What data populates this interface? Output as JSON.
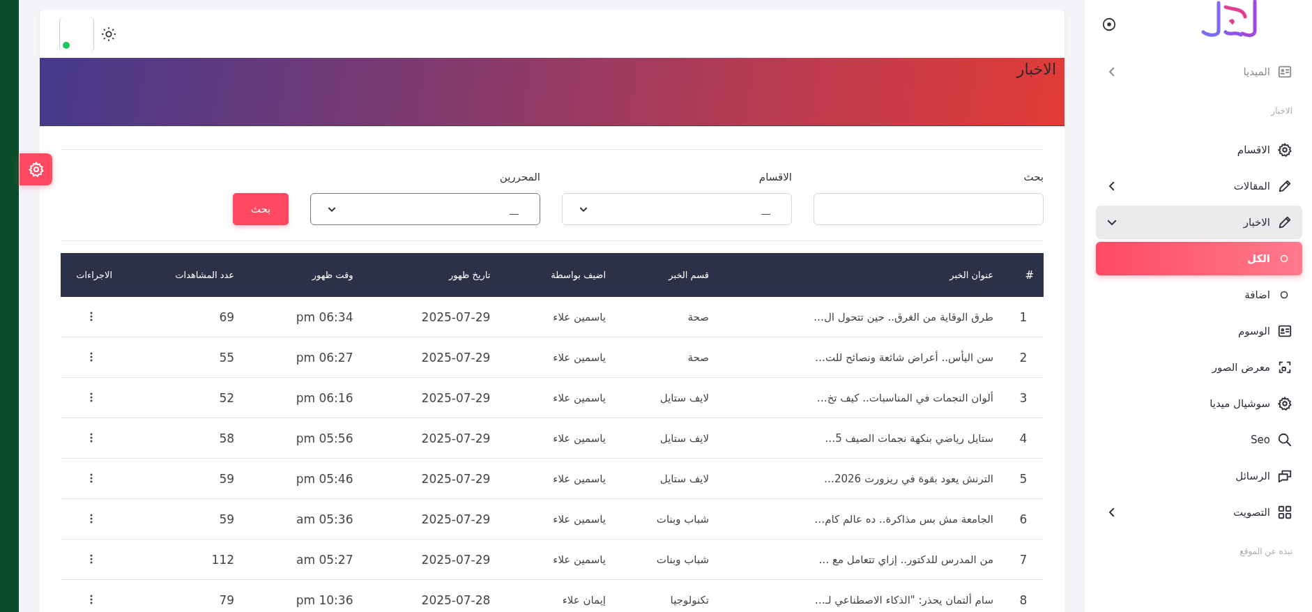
{
  "topbar": {
    "online": true
  },
  "page_title": "الاخبار",
  "filters": {
    "search": {
      "label": "بحث"
    },
    "selects": [
      {
        "label": "الاقسام",
        "value": "__",
        "focused": false
      },
      {
        "label": "المحررين",
        "value": "__",
        "focused": true
      }
    ],
    "button": "بحث"
  },
  "table": {
    "columns": [
      "#",
      "عنوان الخبر",
      "قسم الخبر",
      "اضيف بواسطة",
      "تاريخ ظهور",
      "وقت ظهور",
      "عدد المشاهدات",
      "الاجراءات"
    ],
    "rows": [
      {
        "cells": [
          "1",
          "طرق الوقاية من الغرق.. حين تتحول ال…",
          "صحة",
          "ياسمين علاء",
          "2025-07-29",
          "pm 06:34",
          "69"
        ]
      },
      {
        "cells": [
          "2",
          "سن اليأس.. أعراض شائعة ونصائح للت…",
          "صحة",
          "ياسمين علاء",
          "2025-07-29",
          "pm 06:27",
          "55"
        ]
      },
      {
        "cells": [
          "3",
          "ألوان النجمات في المناسبات.. كيف تخ…",
          "لايف ستايل",
          "ياسمين علاء",
          "2025-07-29",
          "pm 06:16",
          "52"
        ]
      },
      {
        "cells": [
          "4",
          "ستايل رياضي بنكهة نجمات الصيف 5…",
          "لايف ستايل",
          "ياسمين علاء",
          "2025-07-29",
          "pm 05:56",
          "58"
        ]
      },
      {
        "cells": [
          "5",
          "الترنش يعود بقوة في ريزورت 2026…",
          "لايف ستايل",
          "ياسمين علاء",
          "2025-07-29",
          "pm 05:46",
          "59"
        ]
      },
      {
        "cells": [
          "6",
          "الجامعة مش بس مذاكرة.. ده عالم كام…",
          "شباب وبنات",
          "ياسمين علاء",
          "2025-07-29",
          "am 05:36",
          "59"
        ]
      },
      {
        "cells": [
          "7",
          "من المدرس للدكتور.. إزاي تتعامل مع …",
          "شباب وبنات",
          "ياسمين علاء",
          "2025-07-29",
          "am 05:27",
          "112"
        ]
      },
      {
        "cells": [
          "8",
          "سام ألتمان يحذر: \"الذكاء الاصطناعي لـ…",
          "تكنولوجيا",
          "إيمان علاء",
          "2025-07-28",
          "pm 10:36",
          "79"
        ]
      }
    ]
  },
  "sidebar": {
    "items": [
      {
        "kind": "item",
        "label": "الميديا",
        "disabled": true,
        "expanded": false
      },
      {
        "kind": "section",
        "label": "الاخبار"
      },
      {
        "kind": "item",
        "label": "الاقسام",
        "disabled": false
      },
      {
        "kind": "item",
        "label": "المقالات",
        "disabled": false,
        "expanded": false
      },
      {
        "kind": "item",
        "label": "الاخبار",
        "disabled": false,
        "expanded": true,
        "children": [
          {
            "label": "الكل",
            "selected": true
          },
          {
            "label": "اضافة",
            "selected": false
          }
        ]
      },
      {
        "kind": "item",
        "label": "الوسوم",
        "disabled": false
      },
      {
        "kind": "item",
        "label": "معرض الصور",
        "disabled": false
      },
      {
        "kind": "item",
        "label": "سوشيال ميديا",
        "disabled": false
      },
      {
        "kind": "item",
        "label": "Seo",
        "disabled": false
      },
      {
        "kind": "item",
        "label": "الرسائل",
        "disabled": false
      },
      {
        "kind": "item",
        "label": "التصويت",
        "disabled": false,
        "expanded": false
      },
      {
        "kind": "section",
        "label": "نبذه عن الموقع"
      }
    ]
  }
}
